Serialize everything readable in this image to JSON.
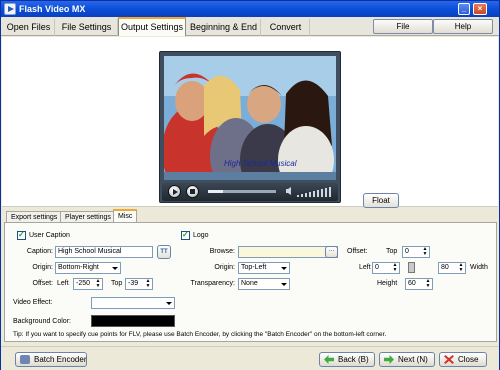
{
  "window": {
    "title": "Flash Video MX"
  },
  "main_tabs": [
    {
      "label": "Open Files"
    },
    {
      "label": "File Settings"
    },
    {
      "label": "Output Settings"
    },
    {
      "label": "Beginning & End"
    },
    {
      "label": "Convert"
    }
  ],
  "menu": {
    "file_label": "File",
    "help_label": "Help"
  },
  "player": {
    "caption_text": "High School Musical",
    "seek_progress": 0.22
  },
  "float_button": "Float",
  "sub_tabs": [
    {
      "label": "Export settings"
    },
    {
      "label": "Player settings"
    },
    {
      "label": "Misc"
    }
  ],
  "caption": {
    "checkbox_label": "User Caption",
    "caption_label": "Caption:",
    "caption_value": "High School Musical",
    "origin_label": "Origin:",
    "origin_value": "Bottom-Right",
    "offset_label": "Offset:",
    "left_label": "Left",
    "left_value": "-250",
    "top_label": "Top",
    "top_value": "-39",
    "font_button": "TT"
  },
  "logo": {
    "checkbox_label": "Logo",
    "browse_label": "Browse:",
    "browse_value": "",
    "browse_button": "···",
    "origin_label": "Origin:",
    "origin_value": "Top-Left",
    "transparency_label": "Transparency:",
    "transparency_value": "None",
    "offset_label": "Offset:",
    "top_label": "Top",
    "top_value": "0",
    "left_label": "Left",
    "left_value": "0",
    "width_value": "80",
    "width_label": "Width",
    "height_label": "Height",
    "height_value": "60"
  },
  "video_effect": {
    "label": "Video Effect:",
    "value": ""
  },
  "background_color": {
    "label": "Background Color:",
    "value": "#000000"
  },
  "tip": "Tip: If you want to specify cue points for FLV, please use Batch Encoder, by clicking the \"Batch Encoder\" on the bottom-left corner.",
  "footer": {
    "batch_label": "Batch Encoder",
    "back_label": "Back (B)",
    "next_label": "Next (N)",
    "close_label": "Close"
  },
  "colors": {
    "titlebar": "#0b4fd8",
    "active_tab_accent": "#f0a830",
    "background": "#ece9d8"
  }
}
